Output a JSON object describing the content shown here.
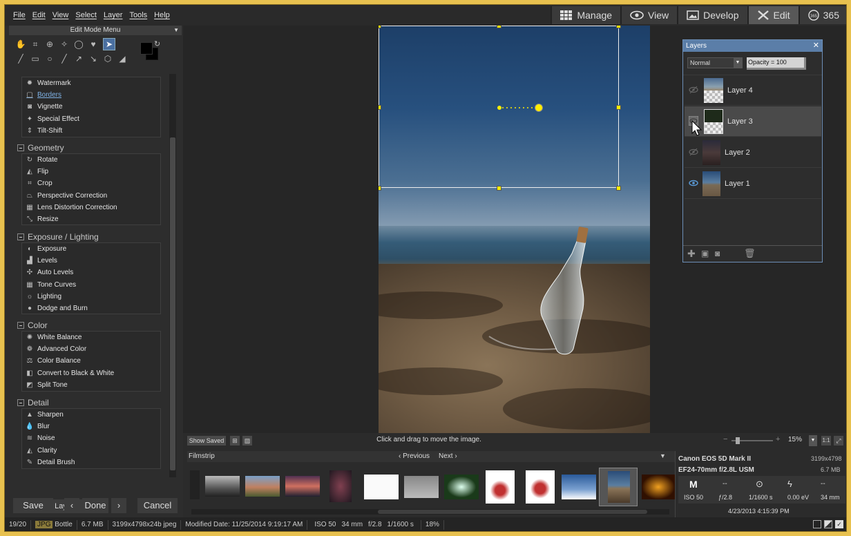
{
  "menu": [
    "File",
    "Edit",
    "View",
    "Select",
    "Layer",
    "Tools",
    "Help"
  ],
  "modes": [
    {
      "label": "Manage",
      "icon": "grid-icon"
    },
    {
      "label": "View",
      "icon": "eye-icon"
    },
    {
      "label": "Develop",
      "icon": "image-icon"
    },
    {
      "label": "Edit",
      "icon": "tools-icon",
      "active": true
    },
    {
      "label": "365",
      "icon": "365-icon"
    }
  ],
  "left": {
    "edit_mode_menu": "Edit Mode Menu",
    "groups": [
      {
        "title": "",
        "items": [
          "Watermark",
          "Borders",
          "Vignette",
          "Special Effect",
          "Tilt-Shift"
        ]
      },
      {
        "title": "Geometry",
        "items": [
          "Rotate",
          "Flip",
          "Crop",
          "Perspective Correction",
          "Lens Distortion Correction",
          "Resize"
        ]
      },
      {
        "title": "Exposure / Lighting",
        "items": [
          "Exposure",
          "Levels",
          "Auto Levels",
          "Tone Curves",
          "Lighting",
          "Dodge and Burn"
        ]
      },
      {
        "title": "Color",
        "items": [
          "White Balance",
          "Advanced Color",
          "Color Balance",
          "Convert to Black & White",
          "Split Tone"
        ]
      },
      {
        "title": "Detail",
        "items": [
          "Sharpen",
          "Blur",
          "Noise",
          "Clarity",
          "Detail Brush"
        ]
      }
    ],
    "hide_layer": "Hide Layer",
    "save": "Save",
    "done": "Done",
    "cancel": "Cancel"
  },
  "canvas": {
    "show_saved": "Show Saved",
    "hint": "Click and drag to move the image.",
    "zoom": "15%"
  },
  "filmstrip": {
    "label": "Filmstrip",
    "previous": "Previous",
    "next": "Next"
  },
  "info": {
    "camera": "Canon EOS 5D Mark II",
    "dimensions": "3199x4798",
    "lens": "EF24-70mm f/2.8L USM",
    "size": "6.7 MB",
    "mode": "M",
    "dash1": "--",
    "dash2": "--",
    "iso": "ISO 50",
    "aperture": "ƒ/2.8",
    "shutter": "1/1600 s",
    "ev": "0.00 eV",
    "focal": "34 mm",
    "date": "4/23/2013 4:15:39 PM"
  },
  "layers": {
    "title": "Layers",
    "blend": "Normal",
    "opacity": "Opacity = 100",
    "items": [
      {
        "name": "Layer 4",
        "visible": false
      },
      {
        "name": "Layer 3",
        "visible": false,
        "selected": true
      },
      {
        "name": "Layer 2",
        "visible": false
      },
      {
        "name": "Layer 1",
        "visible": true
      }
    ]
  },
  "status": {
    "count": "19/20",
    "type": "JPG",
    "name": "Bottle",
    "filesize": "6.7 MB",
    "dims": "3199x4798x24b jpeg",
    "modified": "Modified Date: 11/25/2014 9:19:17 AM",
    "iso": "ISO 50",
    "focal": "34 mm",
    "aperture": "f/2.8",
    "shutter": "1/1600 s",
    "zoom": "18%"
  },
  "colors": {
    "accent": "#5b7ea8",
    "frame": "#e8c14f",
    "handle": "#ffee00"
  }
}
